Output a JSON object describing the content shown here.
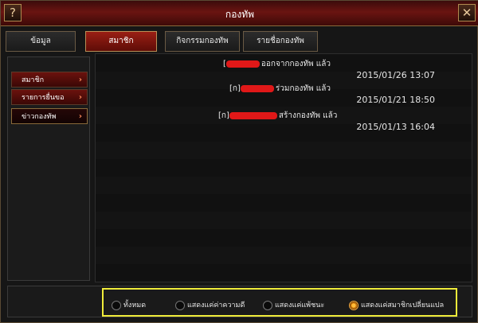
{
  "window": {
    "title": "กองทัพ",
    "help_label": "?",
    "close_label": "✕"
  },
  "tabs": [
    {
      "label": "ข้อมูล",
      "active": false
    },
    {
      "label": "สมาชิก",
      "active": true
    },
    {
      "label": "กิจกรรมกองทัพ",
      "active": false
    },
    {
      "label": "รายชื่อกองทัพ",
      "active": false
    }
  ],
  "sidebar": {
    "items": [
      {
        "label": "สมาชิก",
        "arrow": "›",
        "active": false
      },
      {
        "label": "รายการยื่นขอ",
        "arrow": "›",
        "active": false
      },
      {
        "label": "ข่าวกองทัพ",
        "arrow": "›",
        "active": true
      }
    ]
  },
  "news": [
    {
      "prefix": "[",
      "text": "ออกจากกองทัพ แล้ว",
      "date": "2015/01/26 13:07"
    },
    {
      "prefix": "[ก]",
      "text": "ร่วมกองทัพ แล้ว",
      "date": "2015/01/21 18:50"
    },
    {
      "prefix": "[ก]",
      "text": "สร้างกองทัพ แล้ว",
      "date": "2015/01/13 16:04"
    }
  ],
  "filters": {
    "options": [
      {
        "label": "ทั้งหมด",
        "selected": false
      },
      {
        "label": "แสดงแค่ค่าความดี",
        "selected": false
      },
      {
        "label": "แสดงแค่แพ้ชนะ",
        "selected": false
      },
      {
        "label": "แสดงแค่สมาชิกเปลี่ยนแปล",
        "selected": true
      }
    ]
  },
  "colors": {
    "accent_red": "#6a1411",
    "highlight_yellow": "#f0ec3a",
    "radio_on": "#ffbe3c"
  }
}
